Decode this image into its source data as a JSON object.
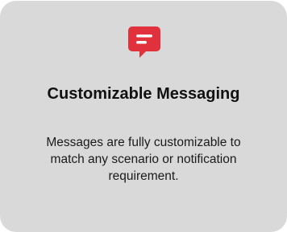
{
  "card": {
    "icon": "message-bubble-icon",
    "icon_color": "#e0313c",
    "title": "Customizable Messaging",
    "description": "Messages are fully customizable to match any scenario or notification requirement."
  }
}
